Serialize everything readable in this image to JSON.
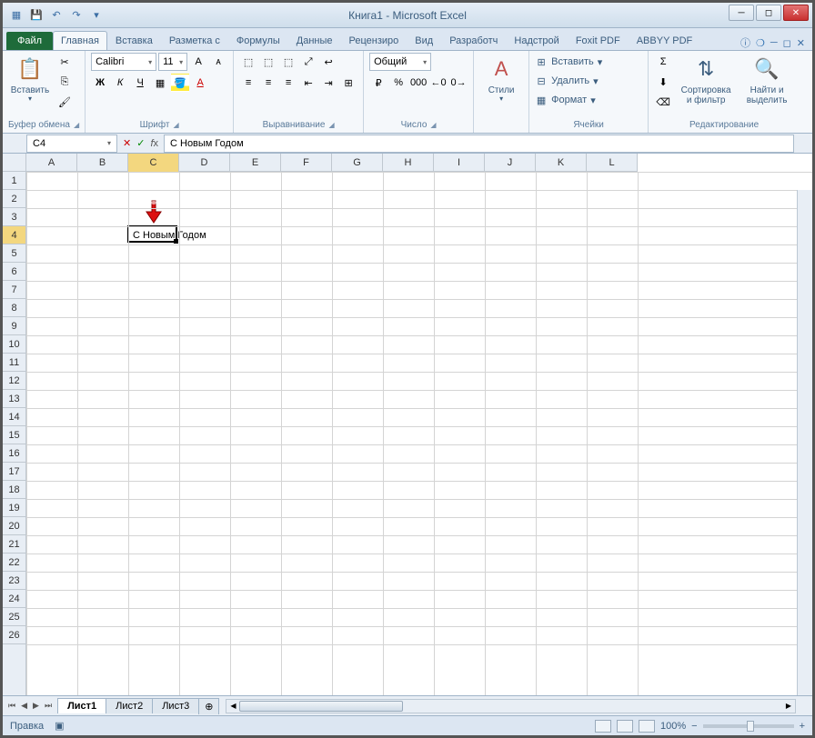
{
  "title": "Книга1 - Microsoft Excel",
  "qat": {
    "save": "💾",
    "undo": "↶",
    "redo": "↷"
  },
  "tabs": {
    "file": "Файл",
    "items": [
      "Главная",
      "Вставка",
      "Разметка с",
      "Формулы",
      "Данные",
      "Рецензиро",
      "Вид",
      "Разработч",
      "Надстрой",
      "Foxit PDF",
      "ABBYY PDF"
    ],
    "active": 0
  },
  "ribbon": {
    "clipboard": {
      "label": "Буфер обмена",
      "paste": "Вставить"
    },
    "font": {
      "label": "Шрифт",
      "name": "Calibri",
      "size": "11"
    },
    "alignment": {
      "label": "Выравнивание"
    },
    "number": {
      "label": "Число",
      "format": "Общий"
    },
    "styles": {
      "label": "",
      "btn": "Стили"
    },
    "cells": {
      "label": "Ячейки",
      "insert": "Вставить",
      "delete": "Удалить",
      "format": "Формат"
    },
    "editing": {
      "label": "Редактирование",
      "sort": "Сортировка и фильтр",
      "find": "Найти и выделить"
    }
  },
  "namebox": "C4",
  "formula": "С Новым Годом",
  "columns": [
    "A",
    "B",
    "C",
    "D",
    "E",
    "F",
    "G",
    "H",
    "I",
    "J",
    "K",
    "L"
  ],
  "rows": 26,
  "active_cell": {
    "col": 2,
    "row": 3,
    "value": "С Новым Годом"
  },
  "sheets": {
    "items": [
      "Лист1",
      "Лист2",
      "Лист3"
    ],
    "active": 0
  },
  "status": {
    "mode": "Правка",
    "zoom": "100%"
  }
}
